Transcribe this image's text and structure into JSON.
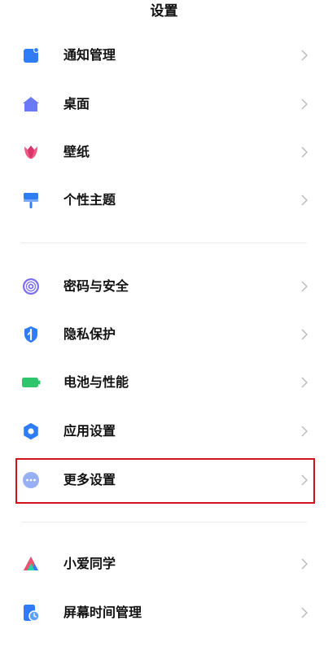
{
  "header": {
    "title": "设置"
  },
  "group1": [
    {
      "label": "通知管理"
    },
    {
      "label": "桌面"
    },
    {
      "label": "壁纸"
    },
    {
      "label": "个性主题"
    }
  ],
  "group2": [
    {
      "label": "密码与安全"
    },
    {
      "label": "隐私保护"
    },
    {
      "label": "电池与性能"
    },
    {
      "label": "应用设置"
    },
    {
      "label": "更多设置"
    }
  ],
  "group3": [
    {
      "label": "小爱同学"
    },
    {
      "label": "屏幕时间管理"
    }
  ],
  "colors": {
    "accent_blue": "#2f80ff",
    "highlight_red": "#d0121b"
  }
}
